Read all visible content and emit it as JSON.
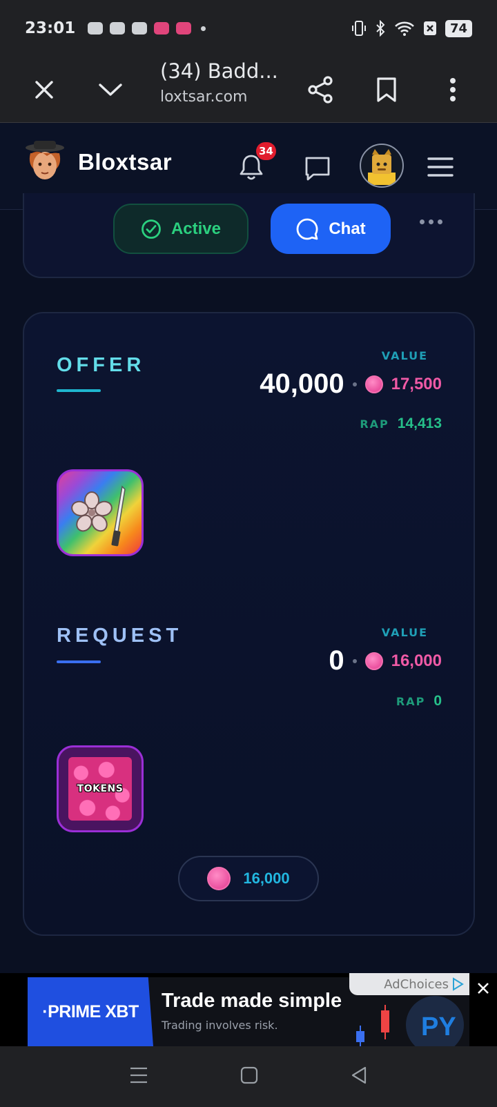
{
  "status_bar": {
    "time": "23:01",
    "battery": "74"
  },
  "browser": {
    "page_title": "(34) Badd...",
    "url": "loxtsar.com"
  },
  "site_header": {
    "brand": "Bloxtsar",
    "notification_count": "34"
  },
  "trade_actions": {
    "active_label": "Active",
    "chat_label": "Chat"
  },
  "offer": {
    "title": "OFFER",
    "value_label": "VALUE",
    "value": "40,000",
    "coin_value": "17,500",
    "rap_label": "RAP",
    "rap_value": "14,413"
  },
  "request": {
    "title": "REQUEST",
    "value_label": "VALUE",
    "value": "0",
    "coin_value": "16,000",
    "rap_label": "RAP",
    "rap_value": "0",
    "item_label": "TOKENS",
    "total_coins": "16,000"
  },
  "ad": {
    "brand": "·PRIME XBT",
    "headline": "Trade made simple",
    "subtext": "Trading involves risk.",
    "adchoices": "AdChoices"
  },
  "colors": {
    "accent_blue": "#1e63f5",
    "active_green": "#2bd07f",
    "coin_pink": "#f05aa6",
    "offer_underline": "#1fb6cf",
    "request_underline": "#3a6ff0"
  }
}
